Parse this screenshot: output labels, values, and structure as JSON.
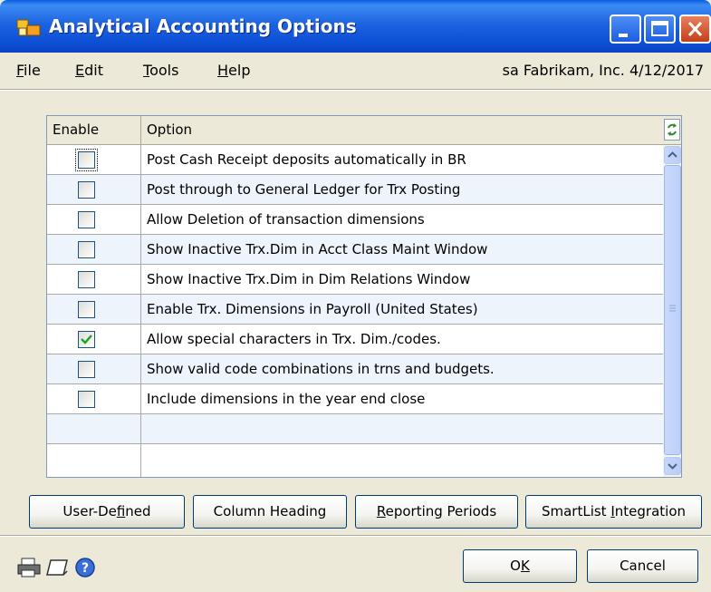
{
  "window": {
    "title": "Analytical Accounting Options",
    "icon": "dynamics-gp-window-icon",
    "controls": [
      "minimize-icon",
      "maximize-icon",
      "close-icon"
    ]
  },
  "menu": {
    "items": [
      {
        "label": "File",
        "mnemonic": "F",
        "rest": "ile"
      },
      {
        "label": "Edit",
        "mnemonic": "E",
        "rest": "dit"
      },
      {
        "label": "Tools",
        "mnemonic": "T",
        "rest": "ools"
      },
      {
        "label": "Help",
        "mnemonic": "H",
        "rest": "elp"
      }
    ],
    "user_info": "sa  Fabrikam, Inc.  4/12/2017"
  },
  "grid": {
    "columns": [
      "Enable",
      "Option"
    ],
    "refresh_icon": "refresh-icon",
    "rows": [
      {
        "enabled": false,
        "option": "Post Cash Receipt deposits automatically in BR"
      },
      {
        "enabled": false,
        "option": "Post through to General Ledger for Trx Posting"
      },
      {
        "enabled": false,
        "option": "Allow Deletion of transaction dimensions"
      },
      {
        "enabled": false,
        "option": "Show Inactive Trx.Dim in Acct Class Maint Window"
      },
      {
        "enabled": false,
        "option": "Show Inactive Trx.Dim in Dim Relations Window"
      },
      {
        "enabled": false,
        "option": "Enable Trx. Dimensions in Payroll (United States)"
      },
      {
        "enabled": true,
        "option": "Allow special characters in Trx. Dim./codes."
      },
      {
        "enabled": false,
        "option": "Show valid code combinations in trns and budgets."
      },
      {
        "enabled": false,
        "option": "Include dimensions in the year end close"
      }
    ]
  },
  "buttons": {
    "user_defined": {
      "pre": "User-De",
      "mn": "f",
      "post": "ined"
    },
    "column_heading": {
      "pre": "Column Heading",
      "mn": "",
      "post": ""
    },
    "reporting_periods": {
      "pre": "",
      "mn": "R",
      "post": "eporting Periods"
    },
    "smartlist": {
      "pre": "SmartList ",
      "mn": "I",
      "post": "ntegration"
    },
    "ok": {
      "pre": "O",
      "mn": "K",
      "post": ""
    },
    "cancel": {
      "pre": "Cancel",
      "mn": "",
      "post": ""
    }
  },
  "footer_icons": [
    "printer-icon",
    "note-icon",
    "help-icon"
  ]
}
